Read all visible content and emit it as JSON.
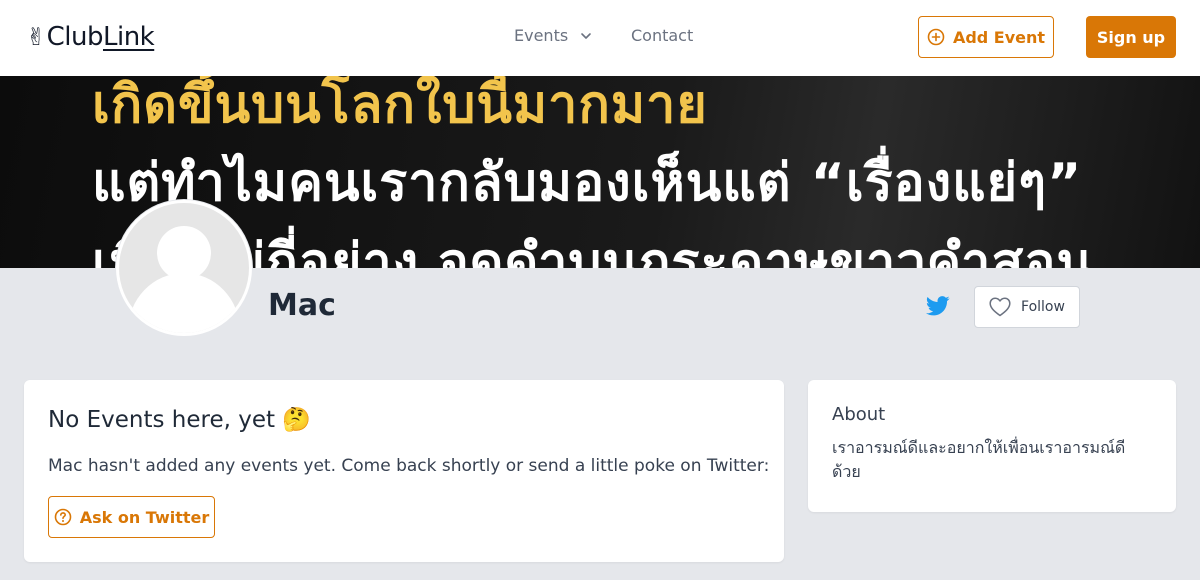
{
  "header": {
    "logo": {
      "hand": "✌",
      "club": "Club",
      "link": "Link"
    },
    "nav": {
      "events_label": "Events",
      "contact_label": "Contact"
    },
    "add_event_label": "Add Event",
    "signup_label": "Sign up"
  },
  "banner": {
    "lines": [
      "เกิดขึ้นบนโลกใบนี้มากมาย",
      "แต่ทำไมคนเรากลับมองเห็นแต่ “เรื่องแย่ๆ”",
      "เพียงไม่กี่อย่าง จดดำบนกระดาษขาวคำสอน"
    ]
  },
  "profile": {
    "name": "Mac",
    "follow_label": "Follow"
  },
  "events": {
    "title": "No Events here, yet 🤔",
    "description": "Mac hasn't added any events yet. Come back shortly or send a little poke on Twitter:",
    "ask_label": "Ask on Twitter"
  },
  "about": {
    "title": "About",
    "text": "เราอารมณ์ดีและอยากให้เพื่อนเราอารมณ์ดีด้วย"
  },
  "colors": {
    "accent": "#d97706",
    "twitter": "#1d9bf0",
    "background": "#e5e7eb"
  }
}
